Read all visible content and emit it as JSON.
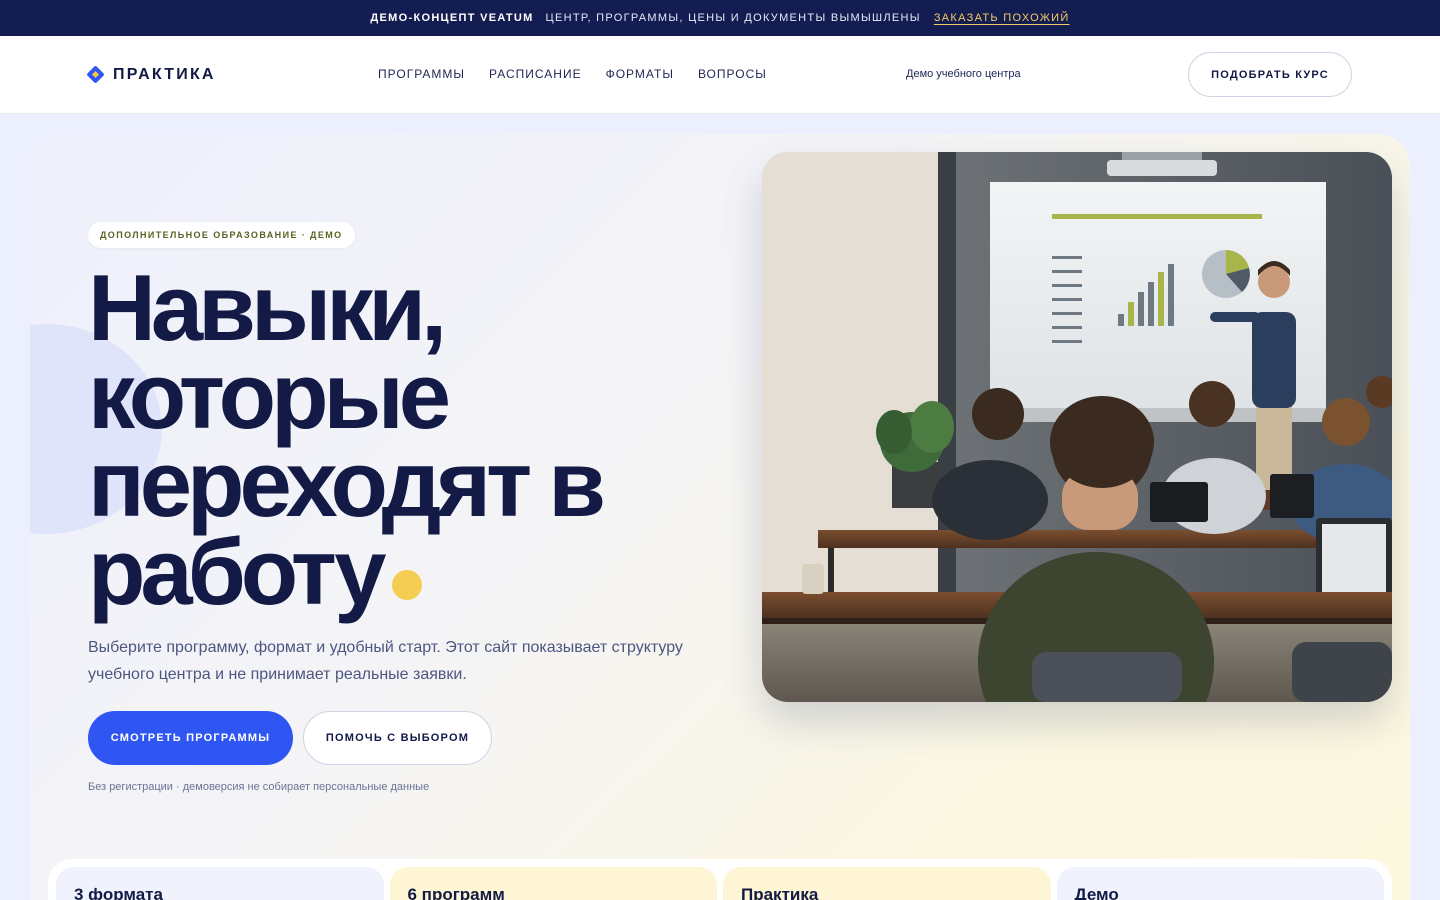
{
  "banner": {
    "strong": "ДЕМО-КОНЦЕПТ VEATUM",
    "text": "ЦЕНТР, ПРОГРАММЫ, ЦЕНЫ И ДОКУМЕНТЫ ВЫМЫШЛЕНЫ",
    "link": "ЗАКАЗАТЬ ПОХОЖИЙ",
    "link_color": "#f2cc63"
  },
  "header": {
    "logo_text": "ПРАКТИКА",
    "nav": [
      "ПРОГРАММЫ",
      "РАСПИСАНИЕ",
      "ФОРМАТЫ",
      "ВОПРОСЫ"
    ],
    "note": "Демо учебного центра",
    "cta": "ПОДОБРАТЬ КУРС"
  },
  "hero": {
    "pill": "ДОПОЛНИТЕЛЬНОЕ ОБРАЗОВАНИЕ · ДЕМО",
    "headline": [
      "Навыки,",
      "которые",
      "переходят в",
      "работу"
    ],
    "lead": "Выберите программу, формат и удобный старт. Этот сайт показывает структуру учебного центра и не принимает реальные заявки.",
    "primary_button": "СМОТРЕТЬ ПРОГРАММЫ",
    "secondary_button": "ПОМОЧЬ С ВЫБОРОМ",
    "fineprint": "Без регистрации · демоверсия не собирает персональные данные",
    "accent_color": "#2f56f2",
    "dot_color": "#f5cd52"
  },
  "stats": [
    "3 формата",
    "6 программ",
    "Практика",
    "Демо"
  ]
}
